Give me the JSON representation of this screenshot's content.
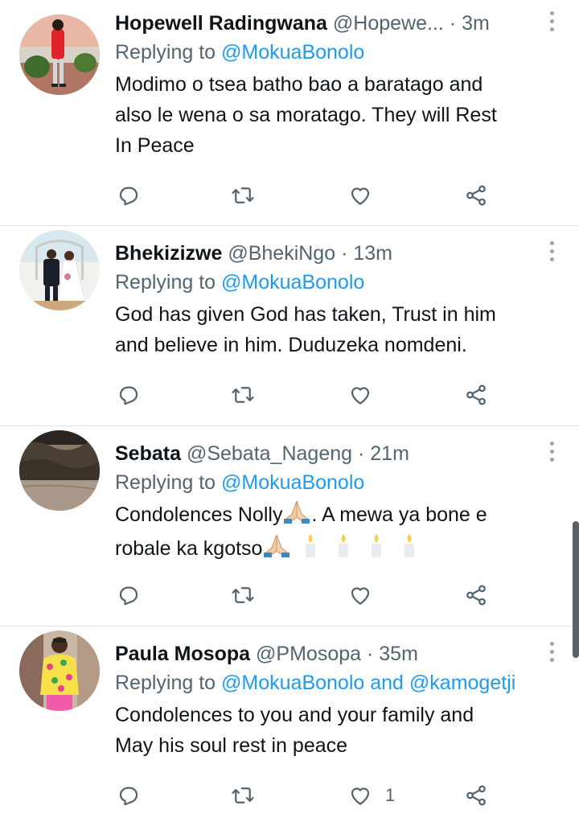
{
  "tweets": [
    {
      "name": "Hopewell Radingwana",
      "handle": "@Hopewe...",
      "sep": "·",
      "time": "3m",
      "reply_prefix": "Replying to ",
      "reply_to": "@MokuaBonolo",
      "reply_and": "",
      "reply_to2": "",
      "text_lines": [
        "Modimo o tsea batho bao a baratago and",
        "also le wena o sa moratago. They will Rest",
        "In Peace"
      ],
      "like_count": ""
    },
    {
      "name": "Bhekizizwe",
      "handle": "@BhekiNgo",
      "sep": "·",
      "time": "13m",
      "reply_prefix": "Replying to ",
      "reply_to": "@MokuaBonolo",
      "reply_and": "",
      "reply_to2": "",
      "text_lines": [
        "God has given God has taken, Trust in him",
        "and believe in him. Duduzeka nomdeni."
      ],
      "like_count": ""
    },
    {
      "name": "Sebata",
      "handle": "@Sebata_Nageng",
      "sep": "·",
      "time": "21m",
      "reply_prefix": "Replying to ",
      "reply_to": "@MokuaBonolo",
      "reply_and": "",
      "reply_to2": "",
      "text_line1_a": "Condolences Nolly",
      "text_line1_b": ". A mewa ya bone e",
      "text_line2": "robale ka kgotso",
      "like_count": ""
    },
    {
      "name": "Paula Mosopa",
      "handle": "@PMosopa",
      "sep": "·",
      "time": "35m",
      "reply_prefix": "Replying to ",
      "reply_to": "@MokuaBonolo",
      "reply_and": " and ",
      "reply_to2": "@kamogetji",
      "text_lines": [
        "Condolences to you and your family and",
        "May his soul rest in peace"
      ],
      "like_count": "1"
    }
  ],
  "icons": {
    "reply": "reply-icon",
    "retweet": "retweet-icon",
    "like": "heart-icon",
    "share": "share-icon",
    "more": "more-vertical-icon",
    "praying_hands": "praying-hands-emoji",
    "candle": "candle-emoji"
  },
  "colors": {
    "text": "#0f1419",
    "secondary": "#536471",
    "link": "#1d9bf0",
    "divider": "#dfe3e6"
  }
}
